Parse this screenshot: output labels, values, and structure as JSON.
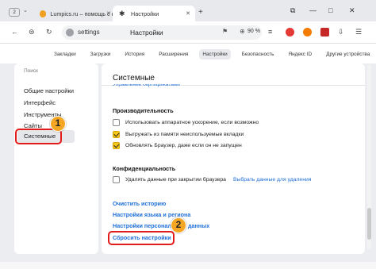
{
  "browser": {
    "tab_count": "2",
    "tabs": [
      {
        "label": "Lumpics.ru – помощь с ко"
      },
      {
        "label": "Настройки"
      }
    ],
    "new_tab_glyph": "+",
    "window_controls": [
      "⧉",
      "—",
      "□",
      "✕"
    ],
    "address": {
      "url": "settings",
      "page_title": "Настройки",
      "zoom": "90 %"
    },
    "icons": [
      "dropdown-caret",
      "lumpics-favicon",
      "gear-icon",
      "close-icon",
      "back-arrow",
      "reload",
      "bookmark-icon",
      "zoom-icon",
      "extension-icons",
      "menu-icon"
    ]
  },
  "settings_nav": {
    "items": [
      "Закладки",
      "Загрузки",
      "История",
      "Расширения",
      "Настройки",
      "Безопасность",
      "Яндекс ID",
      "Другие устройства"
    ],
    "active": "Настройки"
  },
  "sidebar": {
    "search_placeholder": "Поиск",
    "items": [
      "Общие настройки",
      "Интерфейс",
      "Инструменты",
      "Сайты",
      "Системные"
    ],
    "active": "Системные"
  },
  "panel": {
    "title": "Системные",
    "clipped_link": "Управление сертификатами",
    "performance": {
      "title": "Производительность",
      "options": [
        {
          "label": "Использовать аппаратное ускорение, если возможно",
          "checked": false
        },
        {
          "label": "Выгружать из памяти неиспользуемые вкладки",
          "checked": true
        },
        {
          "label": "Обновлять Браузер, даже если он не запущен",
          "checked": true
        }
      ]
    },
    "privacy": {
      "title": "Конфиденциальность",
      "option": {
        "label": "Удалять данные при закрытии браузера",
        "checked": false
      },
      "option_link": "Выбрать данные для удаления"
    },
    "links": [
      "Очистить историю",
      "Настройки языка и региона",
      "Настройки персональных данных",
      "Сбросить настройки"
    ]
  },
  "annotations": {
    "marker_1": "1",
    "marker_2": "2",
    "color": "#e21b1b"
  },
  "colors": {
    "accent_link": "#1e6fd9",
    "checkbox_checked": "#f5c518",
    "marker": "#f5a623"
  }
}
